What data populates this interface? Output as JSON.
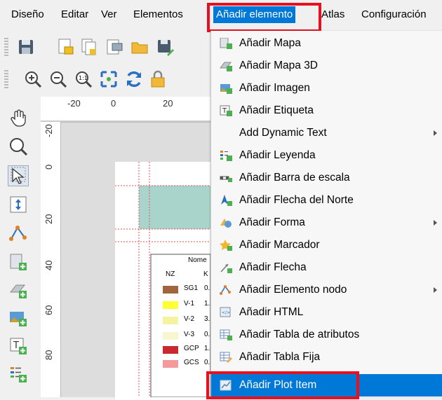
{
  "menubar": {
    "items": [
      {
        "label": "Diseño"
      },
      {
        "label": "Editar"
      },
      {
        "label": "Ver"
      },
      {
        "label": "Elementos"
      },
      {
        "label": "Añadir elemento"
      },
      {
        "label": "Atlas"
      },
      {
        "label": "Configuración"
      }
    ]
  },
  "ruler": {
    "h_ticks": [
      "-20",
      "0",
      "20"
    ],
    "v_ticks": [
      "-20",
      "0",
      "20",
      "40",
      "60",
      "80"
    ]
  },
  "legend": {
    "title": "Nome",
    "header": [
      "NZ",
      "K"
    ],
    "rows": [
      {
        "label": "SG1",
        "value": "0.",
        "color": "#a0673f"
      },
      {
        "label": "V-1",
        "value": "1.",
        "color": "#ffff33"
      },
      {
        "label": "V-2",
        "value": "3.",
        "color": "#f5f2a0"
      },
      {
        "label": "V-3",
        "value": "0.",
        "color": "#f8f6d0"
      },
      {
        "label": "GCP",
        "value": "1.",
        "color": "#c9282d"
      },
      {
        "label": "GCS",
        "value": "0.",
        "color": "#f59a9a"
      }
    ]
  },
  "dropdown": {
    "items": [
      {
        "label": "Añadir Mapa",
        "icon": "map-icon",
        "submenu": false
      },
      {
        "label": "Añadir Mapa 3D",
        "icon": "map-3d-icon",
        "submenu": false
      },
      {
        "label": "Añadir Imagen",
        "icon": "image-icon",
        "submenu": false
      },
      {
        "label": "Añadir Etiqueta",
        "icon": "label-icon",
        "submenu": false
      },
      {
        "label": "Add Dynamic Text",
        "icon": "",
        "submenu": true
      },
      {
        "label": "Añadir Leyenda",
        "icon": "legend-icon",
        "submenu": false
      },
      {
        "label": "Añadir Barra de escala",
        "icon": "scalebar-icon",
        "submenu": false
      },
      {
        "label": "Añadir Flecha del Norte",
        "icon": "north-arrow-icon",
        "submenu": false
      },
      {
        "label": "Añadir Forma",
        "icon": "shape-icon",
        "submenu": true
      },
      {
        "label": "Añadir Marcador",
        "icon": "marker-icon",
        "submenu": false
      },
      {
        "label": "Añadir Flecha",
        "icon": "arrow-icon",
        "submenu": false
      },
      {
        "label": "Añadir Elemento nodo",
        "icon": "node-item-icon",
        "submenu": true
      },
      {
        "label": "Añadir HTML",
        "icon": "html-icon",
        "submenu": false
      },
      {
        "label": "Añadir Tabla de atributos",
        "icon": "attribute-table-icon",
        "submenu": false
      },
      {
        "label": "Añadir Tabla Fija",
        "icon": "fixed-table-icon",
        "submenu": false
      },
      {
        "label": "Añadir Plot Item",
        "icon": "plot-item-icon",
        "submenu": false
      }
    ]
  },
  "colors": {
    "highlight": "#0078d7",
    "annotation": "#e8101f"
  }
}
